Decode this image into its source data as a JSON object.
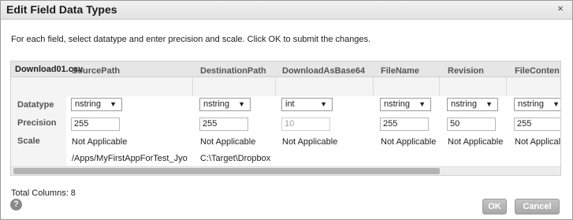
{
  "dialog": {
    "title": "Edit Field Data Types",
    "close_glyph": "×",
    "instructions": "For each field, select datatype and enter precision and scale. Click OK to submit the changes.",
    "total_columns": "Total Columns: 8",
    "ok_label": "OK",
    "cancel_label": "Cancel",
    "help_glyph": "?"
  },
  "grid": {
    "file_name": "Download01.csv",
    "row_labels": {
      "datatype": "Datatype",
      "precision": "Precision",
      "scale": "Scale"
    },
    "columns": [
      {
        "header": "SourcePath",
        "datatype": "nstring",
        "precision": "255",
        "scale": "Not Applicable",
        "value": "/Apps/MyFirstAppForTest_Jyo"
      },
      {
        "header": "DestinationPath",
        "datatype": "nstring",
        "precision": "255",
        "scale": "Not Applicable",
        "value": "C:\\Target\\Dropbox"
      },
      {
        "header": "DownloadAsBase64",
        "datatype": "int",
        "precision": "10",
        "scale": "Not Applicable",
        "value": ""
      },
      {
        "header": "FileName",
        "datatype": "nstring",
        "precision": "255",
        "scale": "Not Applicable",
        "value": ""
      },
      {
        "header": "Revision",
        "datatype": "nstring",
        "precision": "50",
        "scale": "Not Applicable",
        "value": ""
      },
      {
        "header": "FileConten",
        "datatype": "nstring",
        "precision": "255",
        "scale": "Not Applical",
        "value": ""
      }
    ],
    "dropdown_arrow": "▼"
  }
}
